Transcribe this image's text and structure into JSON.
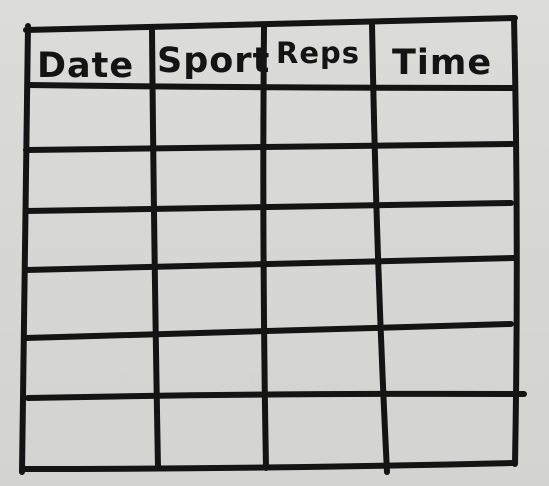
{
  "sheet": {
    "headers": [
      "Date",
      "Sport",
      "Reps",
      "Time"
    ],
    "empty_row_count": 6,
    "paper_color": "#d9d9d7",
    "ink_color": "#141414"
  }
}
